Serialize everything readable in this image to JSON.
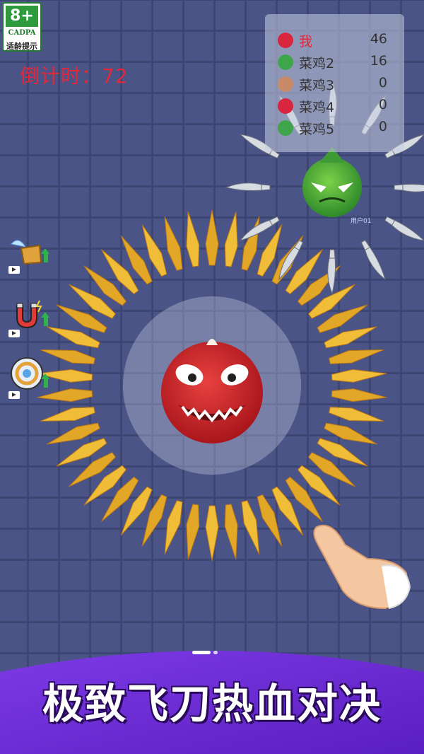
{
  "age_rating": {
    "badge": "8+",
    "org": "CADPA",
    "hint": "适龄提示"
  },
  "countdown": {
    "label": "倒计时：",
    "value": "72"
  },
  "scoreboard": [
    {
      "name": "我",
      "score": "46",
      "color": "#d7263d",
      "me": true
    },
    {
      "name": "菜鸡2",
      "score": "16",
      "color": "#3fa54a",
      "me": false
    },
    {
      "name": "菜鸡3",
      "score": "0",
      "color": "#c98a6a",
      "me": false
    },
    {
      "name": "菜鸡4",
      "score": "0",
      "color": "#d7263d",
      "me": false
    },
    {
      "name": "菜鸡5",
      "score": "0",
      "color": "#3fa54a",
      "me": false
    }
  ],
  "enemy": {
    "label": "用户01"
  },
  "skills": [
    {
      "icon": "winged-boot-icon"
    },
    {
      "icon": "magnet-icon"
    },
    {
      "icon": "shield-ring-icon"
    }
  ],
  "banner": {
    "title": "极致飞刀热血对决"
  },
  "colors": {
    "accent_red": "#e0283a",
    "board": "#4b5486",
    "banner_purple": "#6a2bd6",
    "knife_gold": "#e8b430"
  }
}
